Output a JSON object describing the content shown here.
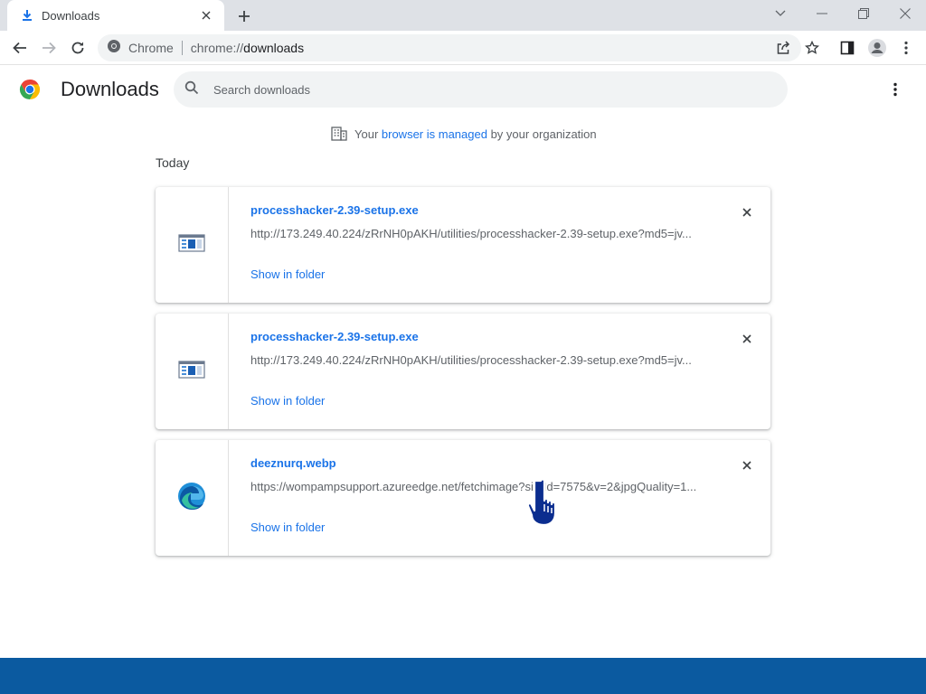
{
  "window": {
    "tab_title": "Downloads",
    "tab_icon": "download-icon"
  },
  "toolbar": {
    "omnibox_chip": "Chrome",
    "url_scheme": "chrome://",
    "url_host": "downloads"
  },
  "page": {
    "title": "Downloads",
    "search_placeholder": "Search downloads",
    "managed_prefix": "Your ",
    "managed_link": "browser is managed",
    "managed_suffix": " by your organization",
    "section_label": "Today"
  },
  "downloads": [
    {
      "filename": "processhacker-2.39-setup.exe",
      "url": "http://173.249.40.224/zRrNH0pAKH/utilities/processhacker-2.39-setup.exe?md5=jv...",
      "action": "Show in folder",
      "icon": "exe-file-icon"
    },
    {
      "filename": "processhacker-2.39-setup.exe",
      "url": "http://173.249.40.224/zRrNH0pAKH/utilities/processhacker-2.39-setup.exe?md5=jv...",
      "action": "Show in folder",
      "icon": "exe-file-icon"
    },
    {
      "filename": "deeznurq.webp",
      "url": "https://wompampsupport.azureedge.net/fetchimage?siteId=7575&v=2&jpgQuality=1...",
      "action": "Show in folder",
      "icon": "edge-file-icon"
    }
  ],
  "colors": {
    "link": "#1a73e8",
    "tabstrip": "#dee1e6",
    "bottom_bar": "#0b5aa0"
  }
}
